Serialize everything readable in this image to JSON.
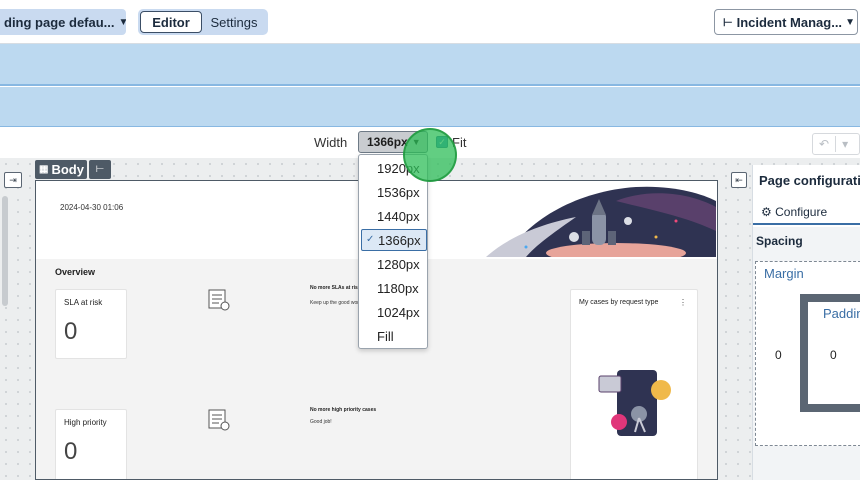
{
  "toolbar": {
    "page_select_label": "ding page defau...",
    "tabs": [
      "Editor",
      "Settings"
    ],
    "app_select_label": "Incident Manag..."
  },
  "width_bar": {
    "label": "Width",
    "selected_value": "1366px",
    "fit_label": "Fit",
    "fit_checked": true
  },
  "width_options": [
    "1920px",
    "1536px",
    "1440px",
    "1366px",
    "1280px",
    "1180px",
    "1024px",
    "Fill"
  ],
  "canvas": {
    "body_tag": "Body",
    "timestamp": "2024-04-30 01:06",
    "overview_title": "Overview",
    "cards": [
      {
        "title": "SLA at risk",
        "value": "0"
      },
      {
        "title": "High priority",
        "value": "0"
      }
    ],
    "notes": [
      {
        "title": "No more SLAs at risk",
        "sub": "Keep up the good work!"
      },
      {
        "title": "No more high priority cases",
        "sub": "Good job!"
      }
    ],
    "cases_card_title": "My cases by request type",
    "cases_card_menu": "⋮"
  },
  "right_panel": {
    "title": "Page configuration",
    "tab": "Configure",
    "section": "Spacing",
    "margin_label": "Margin",
    "margin_value": "0",
    "padding_label": "Padding",
    "padding_value": "0"
  },
  "colors": {
    "accent": "#3a6ea5",
    "banner": "#bcd9f0",
    "highlight": "#2ebe58"
  }
}
